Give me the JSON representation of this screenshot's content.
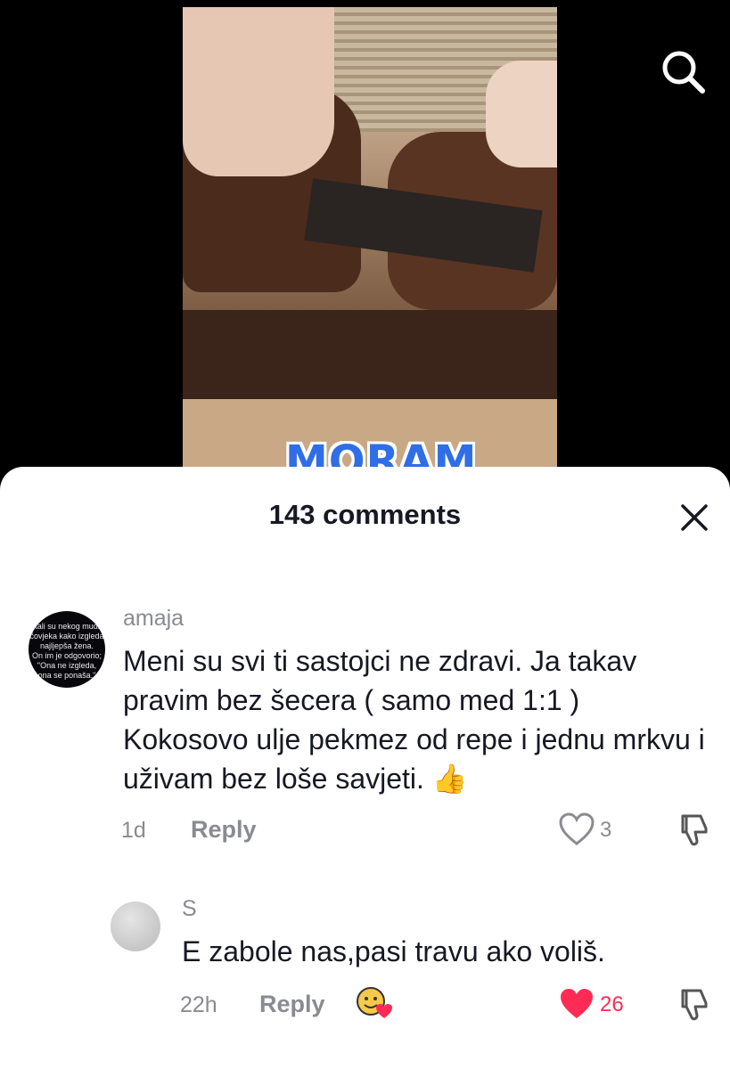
{
  "video": {
    "caption": "MORAM"
  },
  "icons": {
    "search": "search-icon",
    "close": "close-icon",
    "like": "heart-icon",
    "dislike": "thumbs-down-icon",
    "sticker": "sticker-icon"
  },
  "sheet": {
    "title": "143 comments"
  },
  "comments": [
    {
      "avatar_text": [
        "itali su nekog mudr",
        "čovjeka kako izgleda",
        "najljepša žena.",
        "On im je odgovorio;",
        "\"Ona ne izgleda,",
        "ona se ponaša.\""
      ],
      "username": "amaja",
      "text": "Meni su svi ti sastojci ne zdravi. Ja takav pravim bez šecera ( samo med 1:1 ) Kokosovo ulje pekmez od repe i jednu mrkvu i uživam bez loše savjeti.",
      "emoji": "👍",
      "time": "1d",
      "reply_label": "Reply",
      "likes": "3",
      "liked": false
    },
    {
      "username": "S",
      "text": "E zabole nas,pasi travu ako voliš.",
      "time": "22h",
      "reply_label": "Reply",
      "likes": "26",
      "liked": true
    }
  ],
  "colors": {
    "liked": "#fe2c55",
    "muted": "#8a8b91",
    "text": "#161823"
  }
}
